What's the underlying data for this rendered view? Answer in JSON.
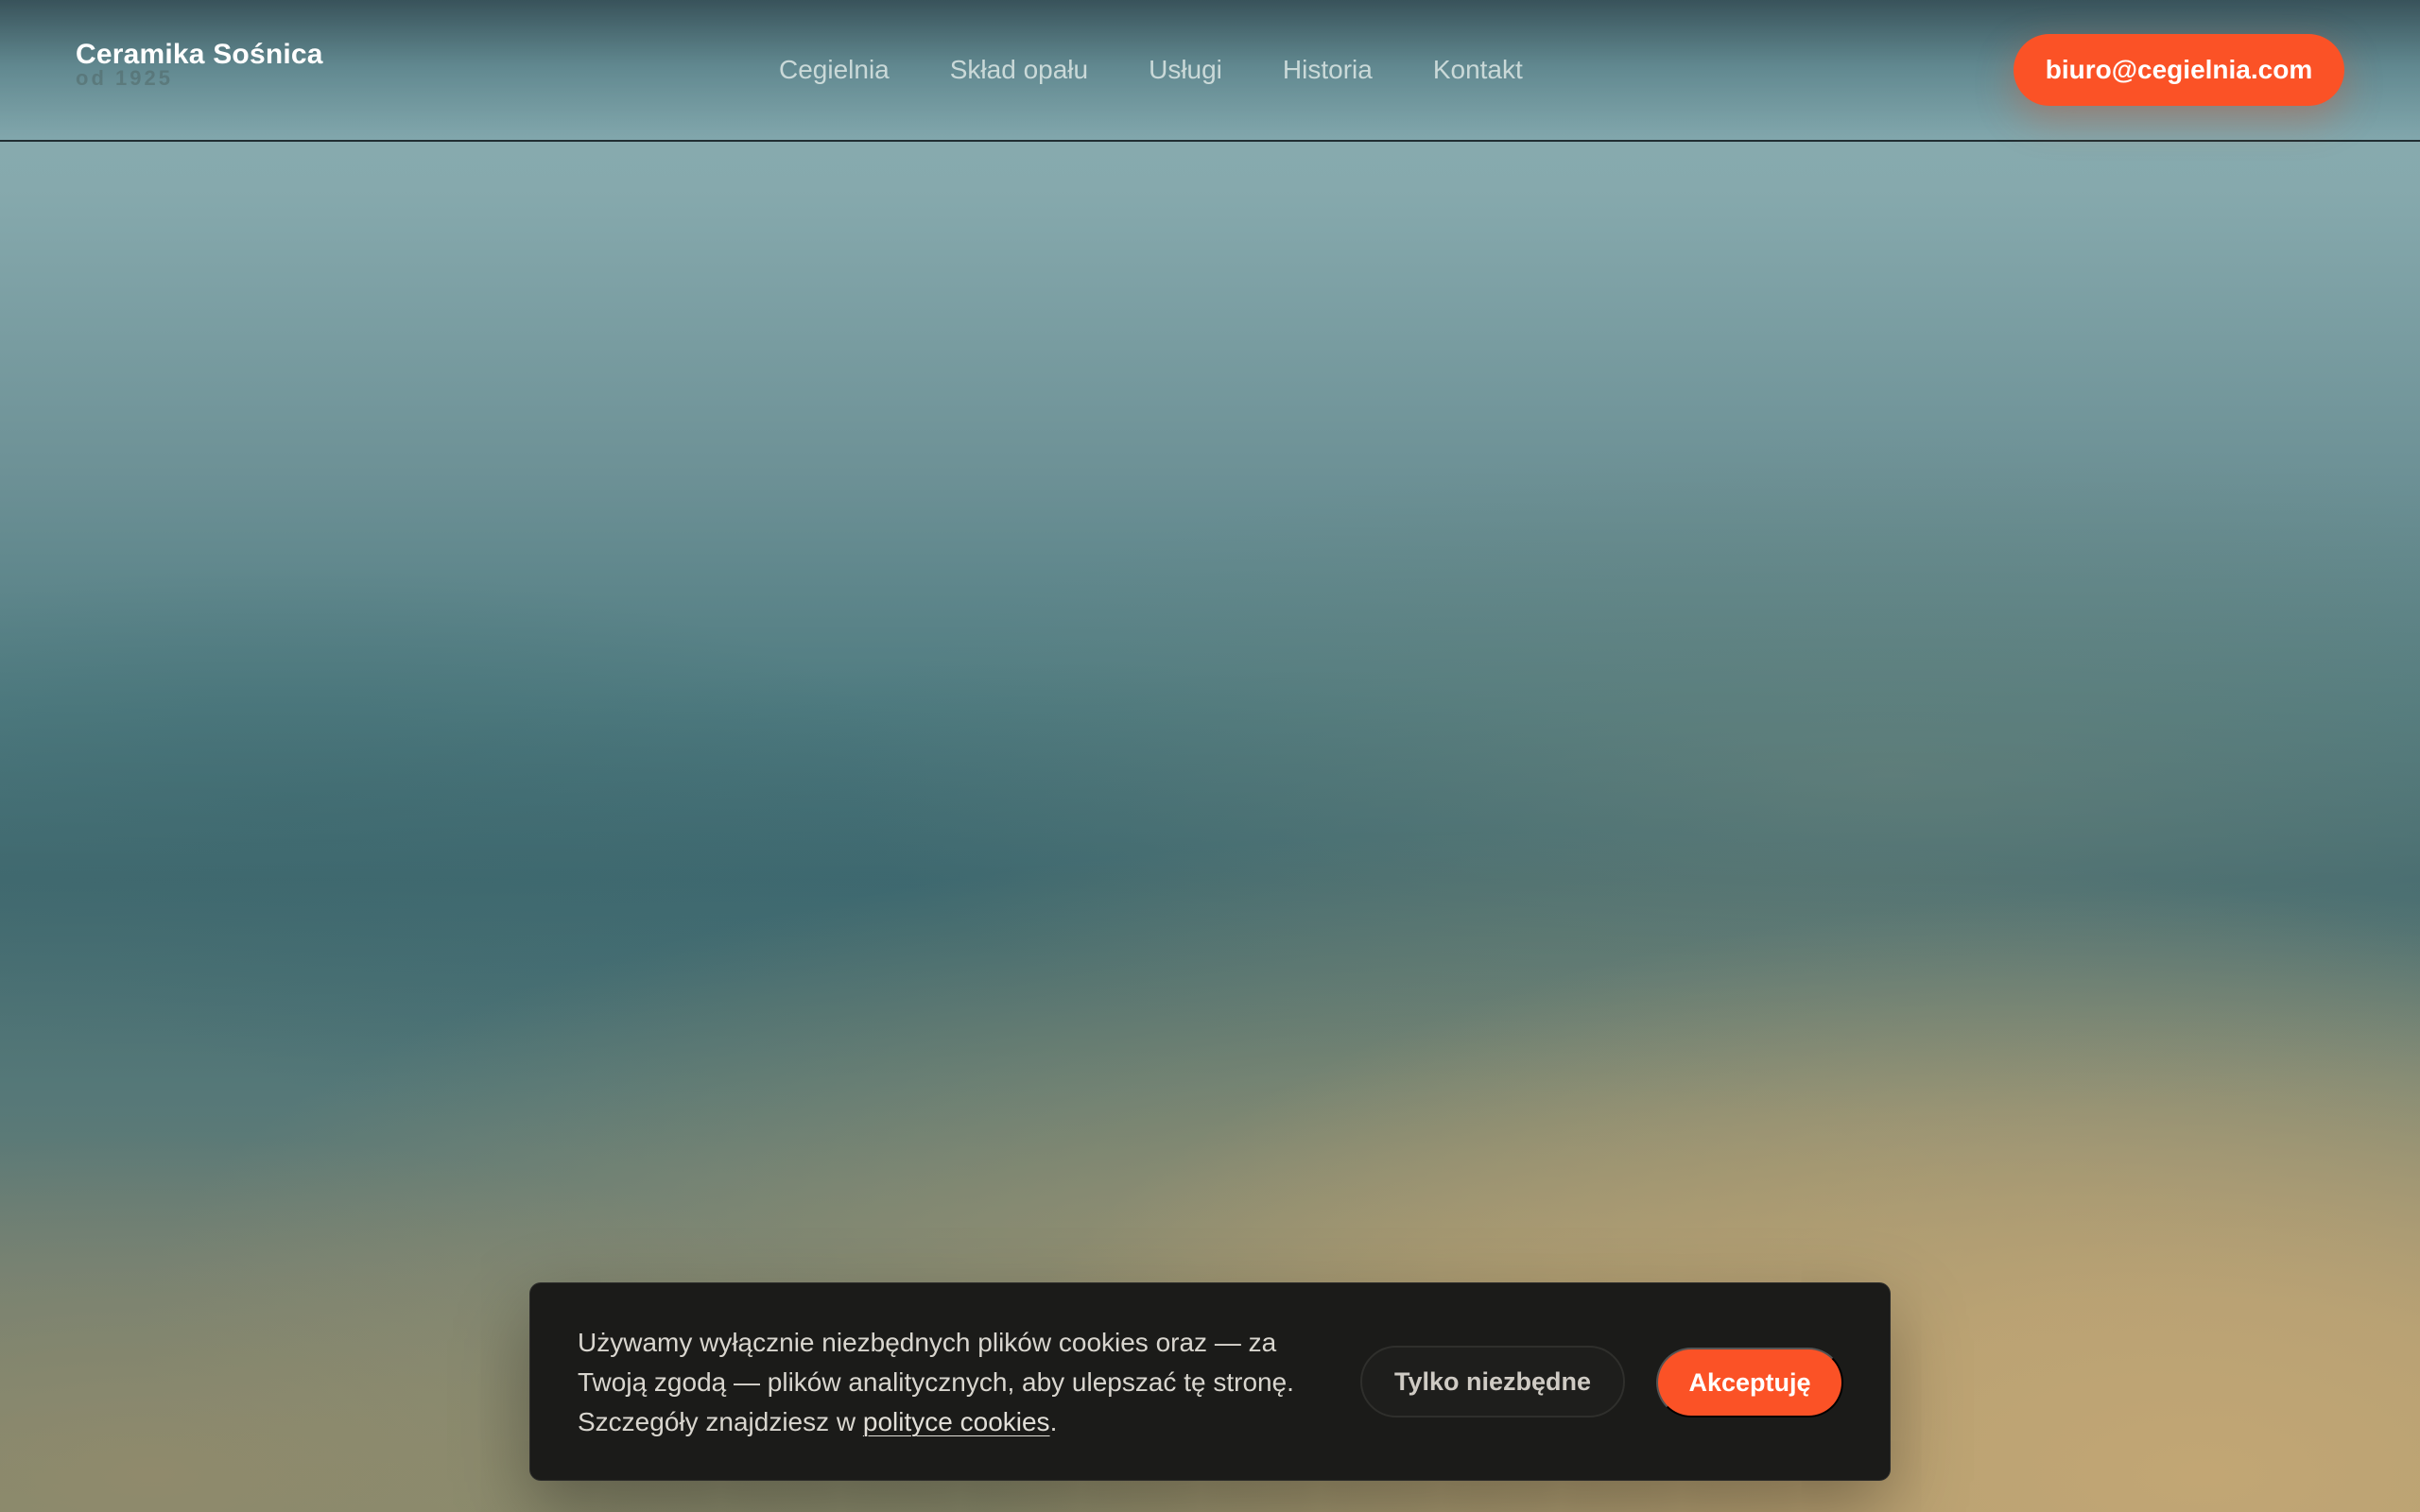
{
  "header": {
    "brand_name": "Ceramika Sośnica",
    "brand_sub": "od 1925",
    "nav": [
      {
        "label": "Cegielnia"
      },
      {
        "label": "Skład opału"
      },
      {
        "label": "Usługi"
      },
      {
        "label": "Historia"
      },
      {
        "label": "Kontakt"
      }
    ],
    "email_label": "biuro@cegielnia.com"
  },
  "cookie": {
    "text_before_link": "Używamy wyłącznie niezbędnych plików cookies oraz — za Twoją zgodą — plików analitycznych, aby ulepszać tę stronę. Szczegóły znajdziesz w ",
    "link_label": "polityce cookies",
    "text_after_link": ".",
    "necessary_label": "Tylko niezbędne",
    "accept_label": "Akceptuję"
  },
  "colors": {
    "accent": "#fb5226",
    "banner_bg": "#1b1b19"
  }
}
